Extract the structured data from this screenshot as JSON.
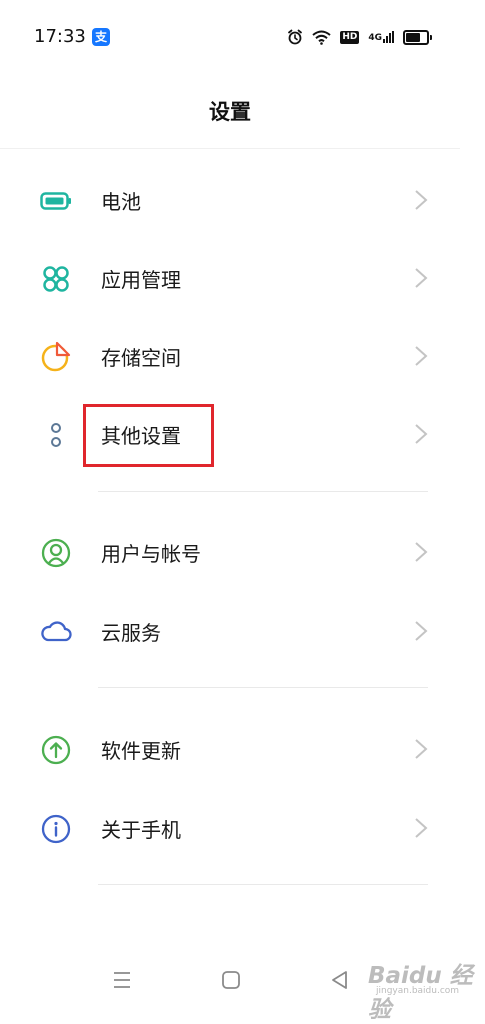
{
  "status": {
    "time": "17:33",
    "pay_badge": "支",
    "hd": "HD",
    "network": "4G"
  },
  "header": {
    "title": "设置"
  },
  "items": [
    {
      "label": "电池",
      "icon": "battery-icon",
      "color": "#1fb5a0"
    },
    {
      "label": "应用管理",
      "icon": "apps-icon",
      "color": "#1fb5a0"
    },
    {
      "label": "存储空间",
      "icon": "storage-icon",
      "color": "#f5b21a"
    },
    {
      "label": "其他设置",
      "icon": "more-settings-icon",
      "color": "#5c7896"
    },
    {
      "label": "用户与帐号",
      "icon": "user-account-icon",
      "color": "#4caf50"
    },
    {
      "label": "云服务",
      "icon": "cloud-icon",
      "color": "#3f63c9"
    },
    {
      "label": "软件更新",
      "icon": "update-icon",
      "color": "#4caf50"
    },
    {
      "label": "关于手机",
      "icon": "info-icon",
      "color": "#3f63c9"
    }
  ],
  "watermark": {
    "text": "Baidu 经验",
    "sub": "jingyan.baidu.com"
  },
  "colors": {
    "highlight": "#e0262c",
    "chevron": "#c4c4c4"
  }
}
